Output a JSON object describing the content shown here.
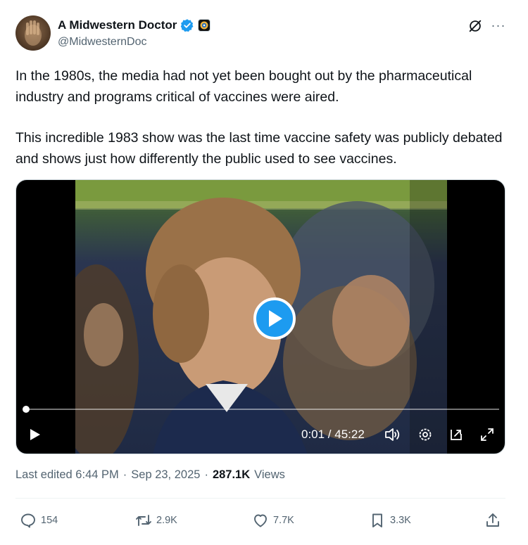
{
  "author": {
    "display_name": "A Midwestern Doctor",
    "handle": "@MidwesternDoc",
    "verified": true,
    "avatar_icon": "raised-hand-avatar",
    "affiliation_icon": "affiliate-badge-icon"
  },
  "header_actions": {
    "grok_icon": "grok-icon",
    "more_label": "···"
  },
  "tweet": {
    "paragraph_1": "In the 1980s, the media had not yet been bought out by the pharmaceutical industry and programs critical of vaccines were aired.",
    "paragraph_2": "This incredible 1983 show was the last time vaccine safety was publicly debated and shows just how differently the public used to see vaccines."
  },
  "video": {
    "time_display": "0:01 / 45:22",
    "progress_fraction": 0.0004,
    "controls": [
      "play-icon",
      "volume-icon",
      "settings-icon",
      "pip-icon",
      "fullscreen-icon"
    ]
  },
  "meta": {
    "edited_label": "Last edited 6:44 PM",
    "separator": "·",
    "date": "Sep 23, 2025",
    "views_count": "287.1K",
    "views_label": "Views"
  },
  "actions": {
    "replies": "154",
    "reposts": "2.9K",
    "likes": "7.7K",
    "bookmarks": "3.3K"
  },
  "colors": {
    "accent": "#1d9bf0",
    "text_primary": "#0f1419",
    "text_secondary": "#536471",
    "divider": "#eff3f4"
  }
}
